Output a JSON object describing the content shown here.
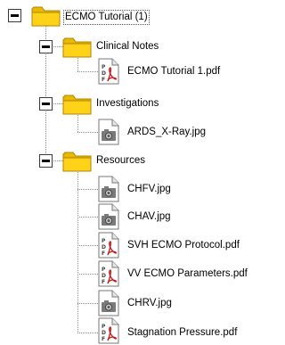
{
  "tree": {
    "root": {
      "label": "ECMO Tutorial (1)",
      "expanded": true,
      "icon": "folder-icon"
    },
    "folders": [
      {
        "label": "Clinical Notes",
        "expanded": true,
        "icon": "folder-icon",
        "files": [
          {
            "label": "ECMO Tutorial 1.pdf",
            "icon": "pdf-file-icon"
          }
        ]
      },
      {
        "label": "Investigations",
        "expanded": true,
        "icon": "folder-icon",
        "files": [
          {
            "label": "ARDS_X-Ray.jpg",
            "icon": "image-file-icon"
          }
        ]
      },
      {
        "label": "Resources",
        "expanded": true,
        "icon": "folder-icon",
        "files": [
          {
            "label": "CHFV.jpg",
            "icon": "image-file-icon"
          },
          {
            "label": "CHAV.jpg",
            "icon": "image-file-icon"
          },
          {
            "label": "SVH ECMO Protocol.pdf",
            "icon": "pdf-file-icon"
          },
          {
            "label": "VV ECMO Parameters.pdf",
            "icon": "pdf-file-icon"
          },
          {
            "label": "CHRV.jpg",
            "icon": "image-file-icon"
          },
          {
            "label": "Stagnation Pressure.pdf",
            "icon": "pdf-file-icon"
          }
        ]
      }
    ]
  },
  "colors": {
    "folder_body": "#ffd21a",
    "folder_tab": "#e8b800",
    "folder_outline": "#b08600",
    "pdf_accent": "#d01010",
    "connector": "#8a8a8a"
  }
}
